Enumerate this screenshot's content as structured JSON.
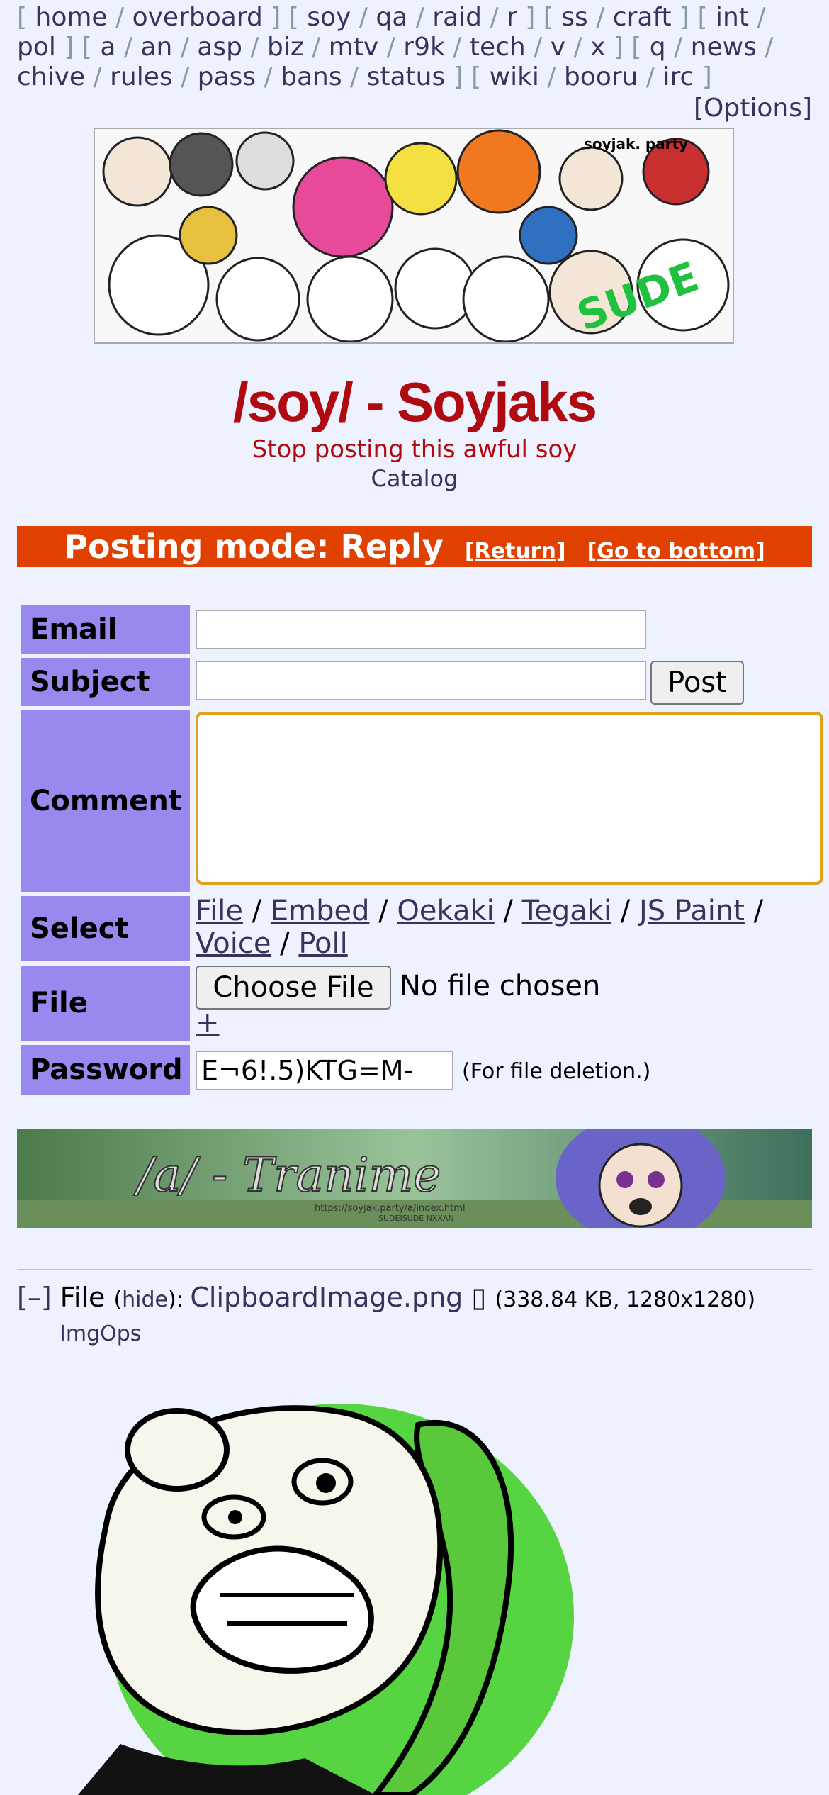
{
  "nav": {
    "groups": [
      [
        "home",
        "overboard"
      ],
      [
        "soy",
        "qa",
        "raid",
        "r"
      ],
      [
        "ss",
        "craft"
      ],
      [
        "int",
        "pol"
      ],
      [
        "a",
        "an",
        "asp",
        "biz",
        "mtv",
        "r9k",
        "tech",
        "v",
        "x"
      ],
      [
        "q",
        "news",
        "chive",
        "rules",
        "pass",
        "bans",
        "status"
      ],
      [
        "wiki",
        "booru",
        "irc"
      ]
    ],
    "options": "[Options]"
  },
  "banner": {
    "watermark": "soyjak. party"
  },
  "board": {
    "title": "/soy/ - Soyjaks",
    "subtitle": "Stop posting this awful soy",
    "catalog": "Catalog"
  },
  "posting_mode": {
    "label": "Posting mode: Reply",
    "return": "[Return]",
    "bottom": "[Go to bottom]"
  },
  "form": {
    "email_label": "Email",
    "subject_label": "Subject",
    "post_button": "Post",
    "comment_label": "Comment",
    "select_label": "Select",
    "select_options": [
      "File",
      "Embed",
      "Oekaki",
      "Tegaki",
      "JS Paint",
      "Voice",
      "Poll"
    ],
    "file_label": "File",
    "choose_file": "Choose File",
    "no_file": "No file chosen",
    "plus": "+",
    "password_label": "Password",
    "password_value": "E¬6!.5)KTG=M-",
    "password_hint": "(For file deletion.)"
  },
  "banner2": {
    "text": "/a/ - Tranime",
    "url": "https://soyjak.party/a/index.html",
    "tag": "SUDEISUDE NXXAN"
  },
  "post": {
    "collapse": "[–]",
    "file_prefix": "File",
    "hide": "hide",
    "filename": "ClipboardImage.png",
    "meta": "(338.84 KB, 1280x1280)",
    "imgops": "ImgOps"
  }
}
